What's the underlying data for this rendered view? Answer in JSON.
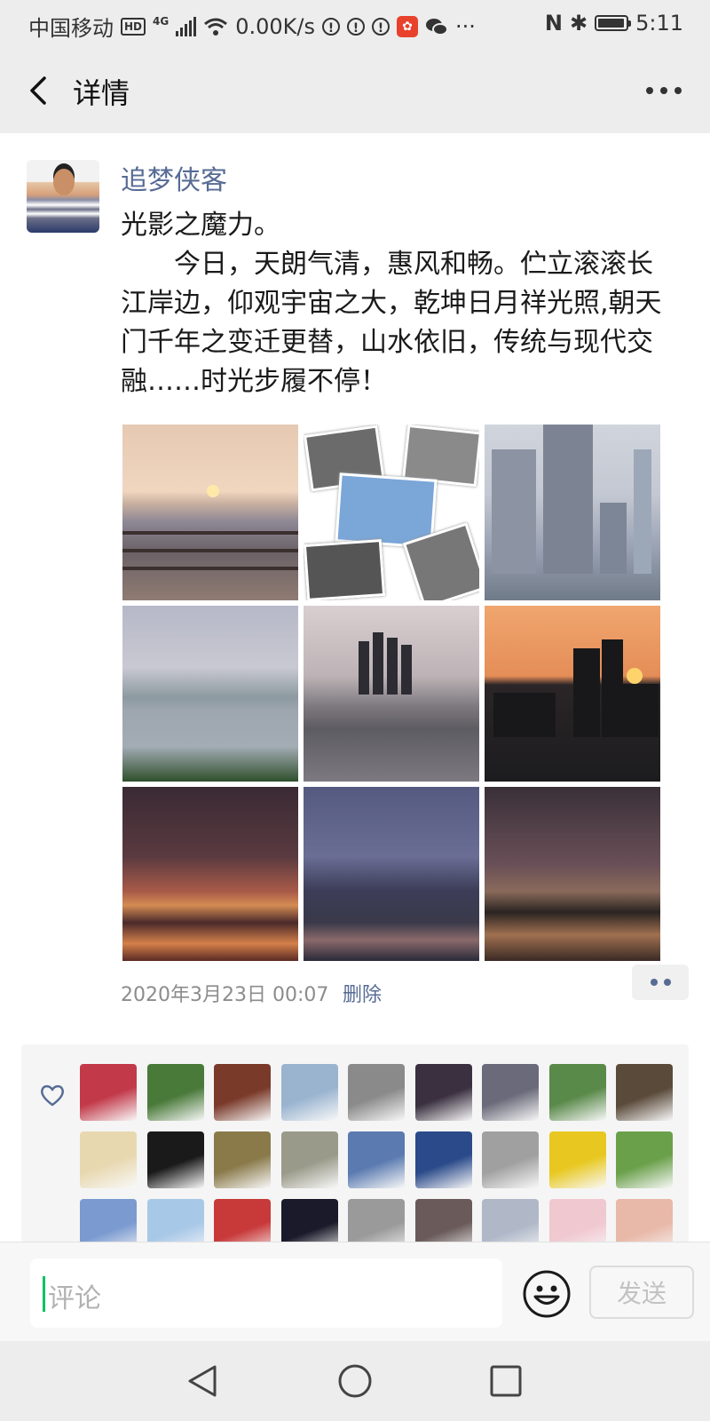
{
  "status_bar": {
    "carrier": "中国移动",
    "hd": "HD",
    "network": "4G",
    "speed": "0.00K/s",
    "alert_mark": "!",
    "nfc": "N",
    "bluetooth": "✱",
    "time": "5:11",
    "icons": [
      "hd-icon",
      "signal-icon",
      "wifi-icon",
      "alert-icon",
      "alert-icon",
      "alert-icon",
      "app-notification-icon",
      "wechat-icon",
      "overflow-dots-icon",
      "nfc-icon",
      "bluetooth-icon",
      "battery-icon"
    ]
  },
  "nav": {
    "title": "详情"
  },
  "post": {
    "username": "追梦侠客",
    "text_title": "光影之魔力。",
    "text_body": "今日，天朗气清，惠风和畅。伫立滚滚长江岸边，仰观宇宙之大，乾坤日月祥光照,朝天门千年之变迁更替，山水依旧，传统与现代交融……时光步履不停！",
    "photos_count": 9,
    "date": "2020年3月23日 00:07",
    "delete_label": "删除"
  },
  "likes": {
    "avatar_colors": [
      "#c23a4a",
      "#4a7a3a",
      "#7a3a2a",
      "#9ab4d0",
      "#8a8a8a",
      "#3a3040",
      "#6a6a7a",
      "#5a8a4a",
      "#5a4a3a",
      "#e8d8b0",
      "#1a1a1a",
      "#8a7a4a",
      "#9a9a8a",
      "#5a7ab0",
      "#2a4a8a",
      "#a0a0a0",
      "#e8c820",
      "#6aa04a",
      "#7a9ad0",
      "#a8c8e8",
      "#c83a3a",
      "#1a1a2a",
      "#9a9a9a",
      "#6a5a5a",
      "#b0b8c8",
      "#f0c8d0",
      "#e8b8a8"
    ]
  },
  "comment": {
    "placeholder": "评论",
    "send_label": "发送"
  },
  "colors": {
    "link": "#576b95",
    "background": "#ededed",
    "cursor": "#07c160"
  }
}
